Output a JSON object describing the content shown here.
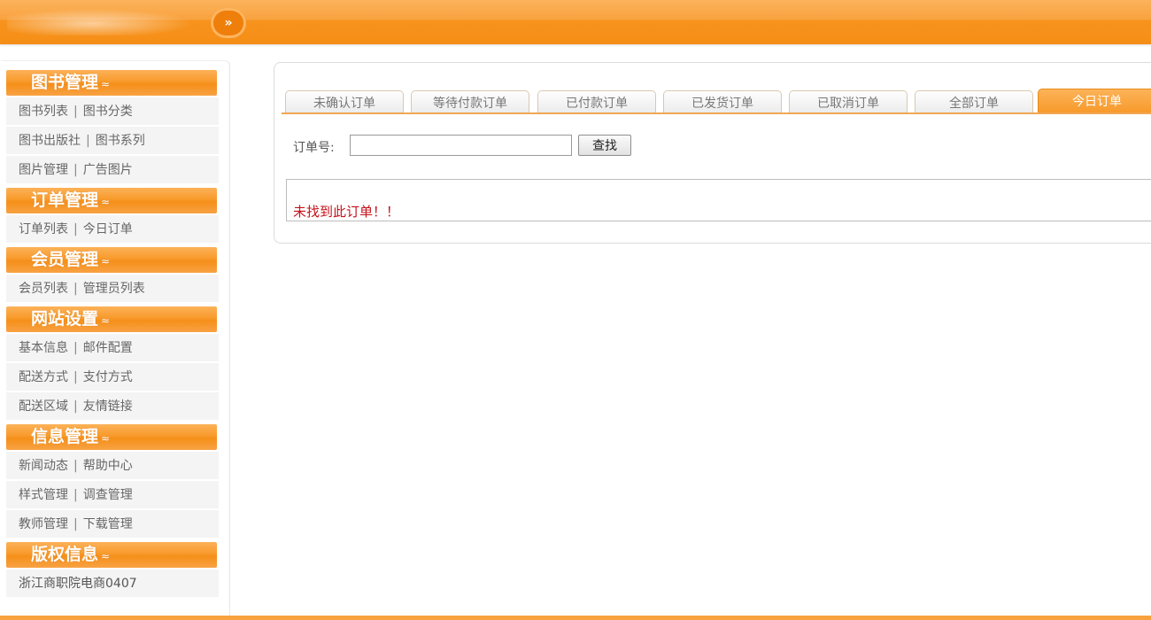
{
  "header": {
    "toggle_glyph": "»"
  },
  "sidebar": {
    "sections": [
      {
        "title": "图书管理",
        "chevron": "≈",
        "rows": [
          [
            "图书列表",
            "图书分类"
          ],
          [
            "图书出版社",
            "图书系列"
          ],
          [
            "图片管理",
            "广告图片"
          ]
        ]
      },
      {
        "title": "订单管理",
        "chevron": "≈",
        "rows": [
          [
            "订单列表",
            "今日订单"
          ]
        ]
      },
      {
        "title": "会员管理",
        "chevron": "≈",
        "rows": [
          [
            "会员列表",
            "管理员列表"
          ]
        ]
      },
      {
        "title": "网站设置",
        "chevron": "≈",
        "rows": [
          [
            "基本信息",
            "邮件配置"
          ],
          [
            "配送方式",
            "支付方式"
          ],
          [
            "配送区域",
            "友情链接"
          ]
        ]
      },
      {
        "title": "信息管理",
        "chevron": "≈",
        "rows": [
          [
            "新闻动态",
            "帮助中心"
          ],
          [
            "样式管理",
            "调查管理"
          ],
          [
            "教师管理",
            "下载管理"
          ]
        ]
      },
      {
        "title": "版权信息",
        "chevron": "≈",
        "footer_text": "浙江商职院电商0407"
      }
    ],
    "separator": "|"
  },
  "main": {
    "tabs": [
      {
        "label": "未确认订单",
        "active": false
      },
      {
        "label": "等待付款订单",
        "active": false
      },
      {
        "label": "已付款订单",
        "active": false
      },
      {
        "label": "已发货订单",
        "active": false
      },
      {
        "label": "已取消订单",
        "active": false
      },
      {
        "label": "全部订单",
        "active": false
      },
      {
        "label": "今日订单",
        "active": true
      }
    ],
    "search": {
      "label": "订单号:",
      "value": "",
      "placeholder": "",
      "button_label": "查找"
    },
    "result_message": "未找到此订单！！"
  },
  "colors": {
    "accent": "#f7931e",
    "error_text": "#c4121a"
  }
}
